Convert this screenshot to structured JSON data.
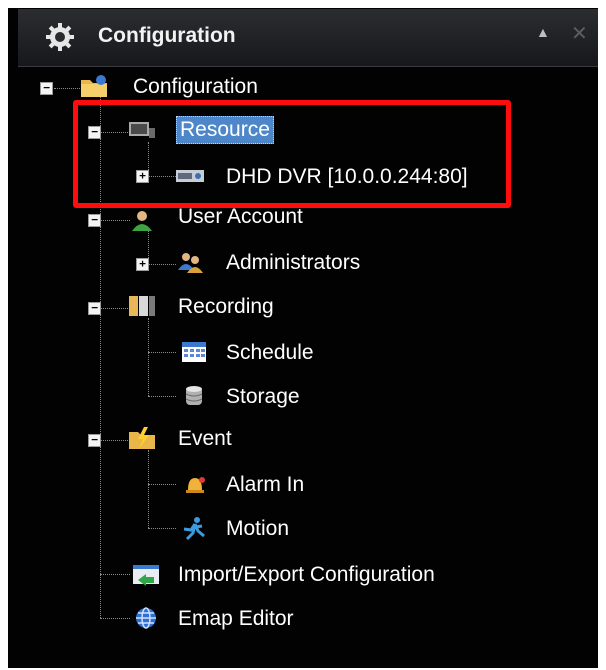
{
  "header": {
    "title": "Configuration",
    "collapse_glyph": "▲",
    "close_glyph": "✕",
    "icon": "gear-icon"
  },
  "tree": {
    "root": {
      "label": "Configuration",
      "icon": "folder-settings-icon",
      "expander": "−"
    },
    "resource": {
      "label": "Resource",
      "icon": "camera-resource-icon",
      "expander": "−",
      "selected": true
    },
    "dvr": {
      "label": "DHD DVR [10.0.0.244:80]",
      "icon": "dvr-device-icon",
      "expander": "+"
    },
    "user_account": {
      "label": "User Account",
      "icon": "user-account-icon",
      "expander": "−"
    },
    "administrators": {
      "label": "Administrators",
      "icon": "user-group-icon",
      "expander": "+"
    },
    "recording": {
      "label": "Recording",
      "icon": "recording-icon",
      "expander": "−"
    },
    "schedule": {
      "label": "Schedule",
      "icon": "calendar-icon"
    },
    "storage": {
      "label": "Storage",
      "icon": "database-icon"
    },
    "event": {
      "label": "Event",
      "icon": "event-icon",
      "expander": "−"
    },
    "alarm_in": {
      "label": "Alarm In",
      "icon": "alarm-bell-icon"
    },
    "motion": {
      "label": "Motion",
      "icon": "motion-runner-icon"
    },
    "import_export": {
      "label": "Import/Export Configuration",
      "icon": "import-export-icon"
    },
    "emap": {
      "label": "Emap Editor",
      "icon": "globe-icon"
    }
  },
  "colors": {
    "panel_bg": "#020202",
    "selection": "#4e87c9",
    "highlight_box": "#ff0c0c"
  }
}
